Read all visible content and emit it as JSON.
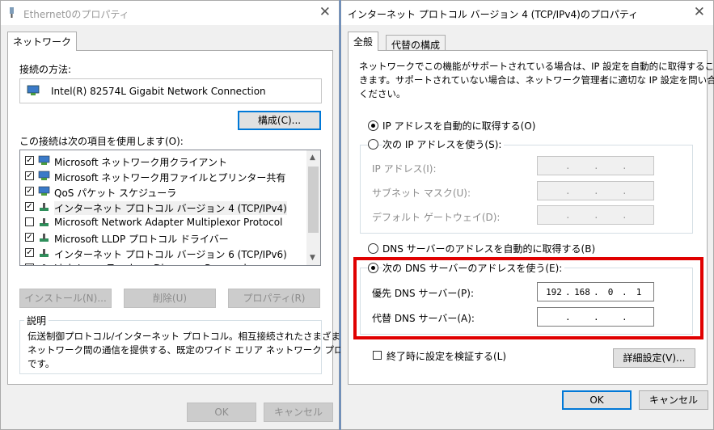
{
  "left": {
    "title": "Ethernet0のプロパティ",
    "tab": "ネットワーク",
    "connect_using_label": "接続の方法:",
    "adapter_name": "Intel(R) 82574L Gigabit Network Connection",
    "configure_button": "構成(C)...",
    "items_label": "この接続は次の項目を使用します(O):",
    "items": [
      {
        "label": "Microsoft ネットワーク用クライアント",
        "checked": true,
        "icon": "network-client-icon"
      },
      {
        "label": "Microsoft ネットワーク用ファイルとプリンター共有",
        "checked": true,
        "icon": "file-printer-sharing-icon"
      },
      {
        "label": "QoS パケット スケジューラ",
        "checked": true,
        "icon": "qos-icon"
      },
      {
        "label": "インターネット プロトコル バージョン 4 (TCP/IPv4)",
        "checked": true,
        "icon": "protocol-icon"
      },
      {
        "label": "Microsoft Network Adapter Multiplexor Protocol",
        "checked": false,
        "icon": "protocol-icon"
      },
      {
        "label": "Microsoft LLDP プロトコル ドライバー",
        "checked": true,
        "icon": "protocol-icon"
      },
      {
        "label": "インターネット プロトコル バージョン 6 (TCP/IPv6)",
        "checked": true,
        "icon": "protocol-icon"
      },
      {
        "label": "Link-Layer Topology Discovery Responder",
        "checked": true,
        "icon": "protocol-icon"
      }
    ],
    "install_button": "インストール(N)...",
    "uninstall_button": "削除(U)",
    "properties_button": "プロパティ(R)",
    "description_label": "説明",
    "description_text_1": "伝送制御プロトコル/インターネット プロトコル。相互接続されたさまざまな",
    "description_text_2": "ネットワーク間の通信を提供する、既定のワイド エリア ネットワーク プロトコル",
    "description_text_3": "です。",
    "ok_button": "OK",
    "cancel_button": "キャンセル"
  },
  "right": {
    "title": "インターネット プロトコル バージョン 4 (TCP/IPv4)のプロパティ",
    "tab_general": "全般",
    "tab_alternate": "代替の構成",
    "intro_1": "ネットワークでこの機能がサポートされている場合は、IP 設定を自動的に取得することがで",
    "intro_2": "きます。サポートされていない場合は、ネットワーク管理者に適切な IP 設定を問い合わせて",
    "intro_3": "ください。",
    "ip_auto": "IP アドレスを自動的に取得する(O)",
    "ip_manual": "次の IP アドレスを使う(S):",
    "ip_address_label": "IP アドレス(I):",
    "subnet_label": "サブネット マスク(U):",
    "gateway_label": "デフォルト ゲートウェイ(D):",
    "dns_auto": "DNS サーバーのアドレスを自動的に取得する(B)",
    "dns_manual": "次の DNS サーバーのアドレスを使う(E):",
    "preferred_dns_label": "優先 DNS サーバー(P):",
    "preferred_dns": [
      "192",
      "168",
      "0",
      "1"
    ],
    "alternate_dns_label": "代替 DNS サーバー(A):",
    "validate_label": "終了時に設定を検証する(L)",
    "advanced_button": "詳細設定(V)...",
    "ok_button": "OK",
    "cancel_button": "キャンセル",
    "ip_mode": "auto",
    "dns_mode": "manual",
    "validate_checked": false
  },
  "colors": {
    "highlight": "#e00000",
    "accent": "#0078d7",
    "desktop": "#1f6bd0"
  }
}
